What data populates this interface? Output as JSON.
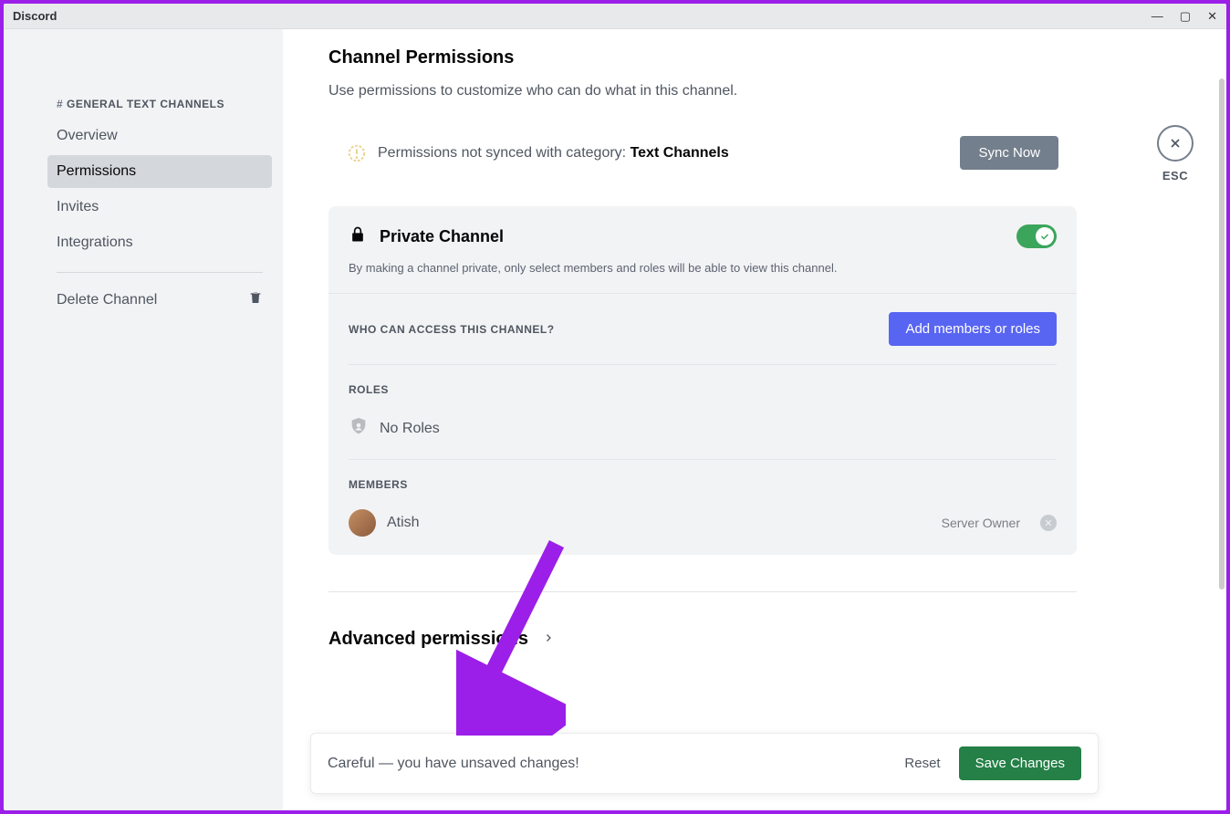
{
  "titlebar": {
    "title": "Discord"
  },
  "sidebar": {
    "header_prefix": "#",
    "header_channel": "GENERAL",
    "header_suffix": "TEXT CHANNELS",
    "items": [
      {
        "label": "Overview",
        "active": false
      },
      {
        "label": "Permissions",
        "active": true
      },
      {
        "label": "Invites",
        "active": false
      },
      {
        "label": "Integrations",
        "active": false
      }
    ],
    "delete_label": "Delete Channel"
  },
  "page": {
    "title": "Channel Permissions",
    "subtitle": "Use permissions to customize who can do what in this channel."
  },
  "sync": {
    "text_prefix": "Permissions not synced with category: ",
    "category": "Text Channels",
    "button": "Sync Now"
  },
  "private": {
    "title": "Private Channel",
    "desc": "By making a channel private, only select members and roles will be able to view this channel.",
    "toggled_on": true
  },
  "access": {
    "header": "WHO CAN ACCESS THIS CHANNEL?",
    "add_button": "Add members or roles"
  },
  "roles": {
    "header": "ROLES",
    "empty": "No Roles"
  },
  "members": {
    "header": "MEMBERS",
    "list": [
      {
        "name": "Atish",
        "tag": "Server Owner"
      }
    ]
  },
  "advanced": {
    "title": "Advanced permissions"
  },
  "esc": {
    "label": "ESC"
  },
  "toast": {
    "text": "Careful — you have unsaved changes!",
    "reset": "Reset",
    "save": "Save Changes"
  }
}
